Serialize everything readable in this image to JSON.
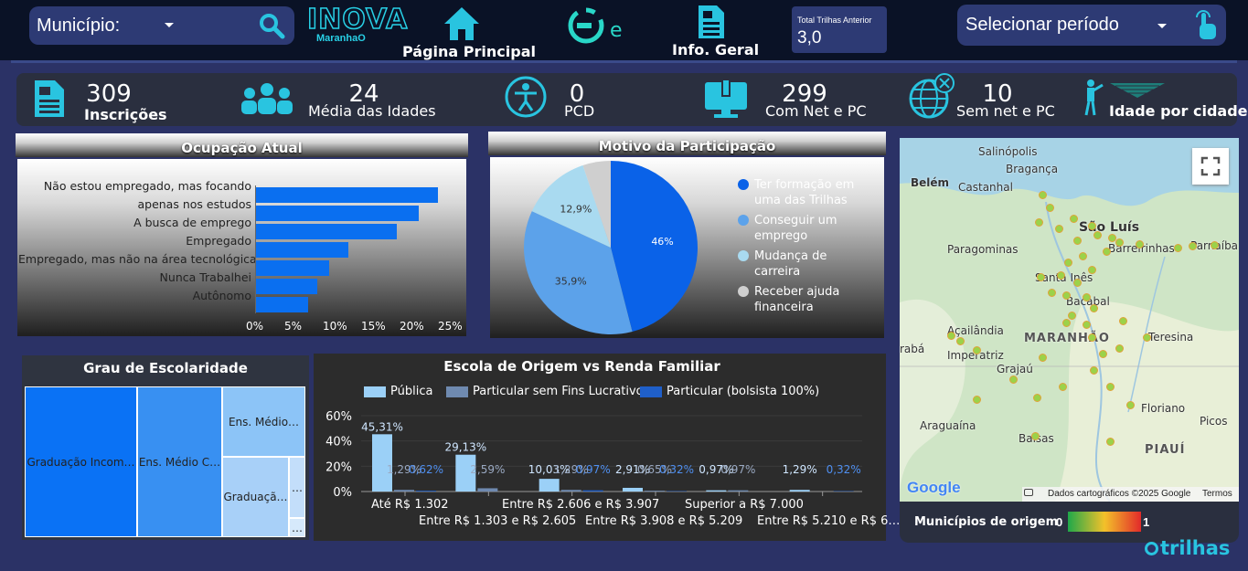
{
  "header": {
    "municipio_label": "Município:",
    "logo_text": "INOVA",
    "logo_subtext": "MaranhaO",
    "nav_home_label": "Página Principal",
    "nav_info_label": "Info. Geral",
    "trilhas_anterior_label": "Total Trilhas Anterior",
    "trilhas_anterior_value": "3,0",
    "periodo_label": "Selecionar período"
  },
  "kpis": [
    {
      "value": "309",
      "label": "Inscrições"
    },
    {
      "value": "24",
      "label": "Média das Idades"
    },
    {
      "value": "0",
      "label": "PCD"
    },
    {
      "value": "299",
      "label": "Com Net e PC"
    },
    {
      "value": "10",
      "label": "Sem net e PC"
    },
    {
      "value": "",
      "label": "Idade por cidade"
    }
  ],
  "ocupacao": {
    "title": "Ocupação Atual",
    "chart_data": {
      "type": "bar",
      "orientation": "horizontal",
      "categories": [
        "Não estou empregado, mas focando apenas nos estudos",
        "",
        "A busca de emprego",
        "Empregado",
        "Empregado, mas não na área tecnológica",
        "Nunca Trabalhei",
        "Autônomo"
      ],
      "category_labels": [
        "Não estou empregado, mas focando",
        "apenas nos estudos",
        "A busca de emprego",
        "Empregado",
        "Empregado, mas não na área tecnológica",
        "Nunca Trabalhei",
        "Autônomo"
      ],
      "values": [
        23.8,
        21.3,
        18.4,
        12.2,
        9.7,
        8.1,
        6.9
      ],
      "xticks": [
        "0%",
        "5%",
        "10%",
        "15%",
        "20%",
        "25%"
      ],
      "xlim": [
        0,
        25
      ],
      "color": "#0a6ff0"
    }
  },
  "motivo": {
    "title": "Motivo da Participação",
    "chart_data": {
      "type": "pie",
      "slices": [
        {
          "name": "Ter formação em uma das Trilhas",
          "value": 46,
          "label": "46%",
          "color": "#0a62e8"
        },
        {
          "name": "Conseguir um emprego",
          "value": 35.9,
          "label": "35,9%",
          "color": "#5ca2ea"
        },
        {
          "name": "Mudança de carreira",
          "value": 12.9,
          "label": "12,9%",
          "color": "#a9daf0"
        },
        {
          "name": "Receber ajuda financeira",
          "value": 5.2,
          "label": "",
          "color": "#cfcfcf"
        }
      ],
      "legend": [
        [
          "Ter formação em",
          "uma das Trilhas"
        ],
        [
          "Conseguir um",
          "emprego"
        ],
        [
          "Mudança de",
          "carreira"
        ],
        [
          "Receber ajuda",
          "financeira"
        ]
      ]
    }
  },
  "escolaridade": {
    "title": "Grau de Escolaridade",
    "cells": [
      {
        "label": "Graduação Incom…",
        "color": "#0a72f5"
      },
      {
        "label": "Ens. Médio C…",
        "color": "#3890f2"
      },
      {
        "label": "Ens. Médio…",
        "color": "#8cc4f7"
      },
      {
        "label": "Graduaçã…",
        "color": "#a8d0f8"
      },
      {
        "label": "…",
        "color": "#c3defa"
      },
      {
        "label": "…",
        "color": "#d6e9fb"
      }
    ]
  },
  "escola_renda": {
    "title": "Escola de Origem vs Renda Familiar",
    "chart_data": {
      "type": "bar",
      "categories": [
        "Até R$ 1.302",
        "Entre R$ 1.303 e R$ 2.605",
        "Entre R$ 2.606 e R$ 3.907",
        "Entre R$ 3.908 e R$ 5.209",
        "Superior a R$ 7.000",
        "Entre R$ 5.210 e R$ 6…"
      ],
      "series": [
        {
          "name": "Pública",
          "color": "#9bd0f7",
          "values": [
            45.31,
            29.13,
            10.03,
            2.91,
            0.97,
            1.29
          ],
          "labels": [
            "45,31%",
            "29,13%",
            "10,03%",
            "2,91%",
            "0,97%",
            "1,29%"
          ]
        },
        {
          "name": "Particular sem Fins Lucrativos",
          "color": "#6f8ab0",
          "values": [
            1.29,
            2.59,
            1.29,
            0.65,
            0.97,
            0
          ],
          "labels": [
            "1,29%",
            "2,59%",
            "1,29%",
            "0,65%",
            "0,97%",
            ""
          ]
        },
        {
          "name": "Particular (bolsista 100%)",
          "color": "#1f5fc9",
          "values": [
            0.62,
            0,
            0.97,
            0.32,
            0,
            0.32
          ],
          "labels": [
            "0,62%",
            "",
            "0,97%",
            "0,32%",
            "",
            "0,32%"
          ]
        }
      ],
      "yticks": [
        "0%",
        "20%",
        "40%",
        "60%"
      ],
      "ylim": [
        0,
        60
      ]
    }
  },
  "map": {
    "cities": [
      "Salinópolis",
      "Bragança",
      "Belém",
      "Castanhal",
      "São Luís",
      "Barreirinhas",
      "Parnaíba",
      "Paragominas",
      "Santa Inês",
      "Bacabal",
      "Açailândia",
      "MARANHÃO",
      "Teresina",
      "Imperatriz",
      "Grajaú",
      "Floriano",
      "Araguaína",
      "Balsas",
      "Picos",
      "PIAUÍ",
      "rabá"
    ],
    "attribution": "Dados cartográficos ©2025 Google",
    "terms": "Termos",
    "google": "Google",
    "legend_label": "Municípios de origem",
    "legend_min": "0",
    "legend_max": "1"
  },
  "brand": "trilhas"
}
